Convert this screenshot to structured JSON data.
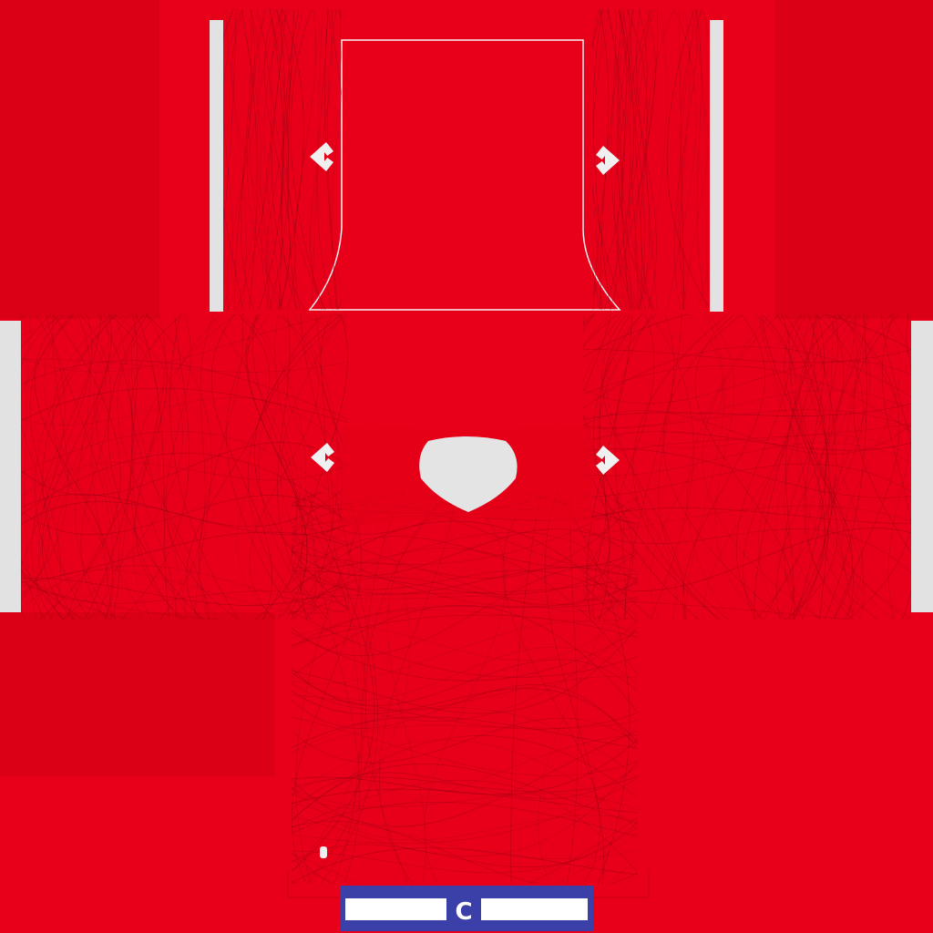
{
  "kit_texture": {
    "colors": {
      "base_red": "#e8001a",
      "dark_red_panel": "#db0015",
      "pattern_line": "#8a0010",
      "trim_white": "#e2e2e2",
      "captain_blue": "#3b3fa8"
    },
    "parts": [
      "collar-back",
      "left-sleeve-short",
      "right-sleeve-short",
      "left-sleeve-long",
      "right-sleeve-long",
      "shirt-front",
      "shirt-back"
    ],
    "icons": [
      "brand-logo-icon",
      "club-crest-icon"
    ],
    "captain_armband": {
      "letter": "C"
    }
  }
}
